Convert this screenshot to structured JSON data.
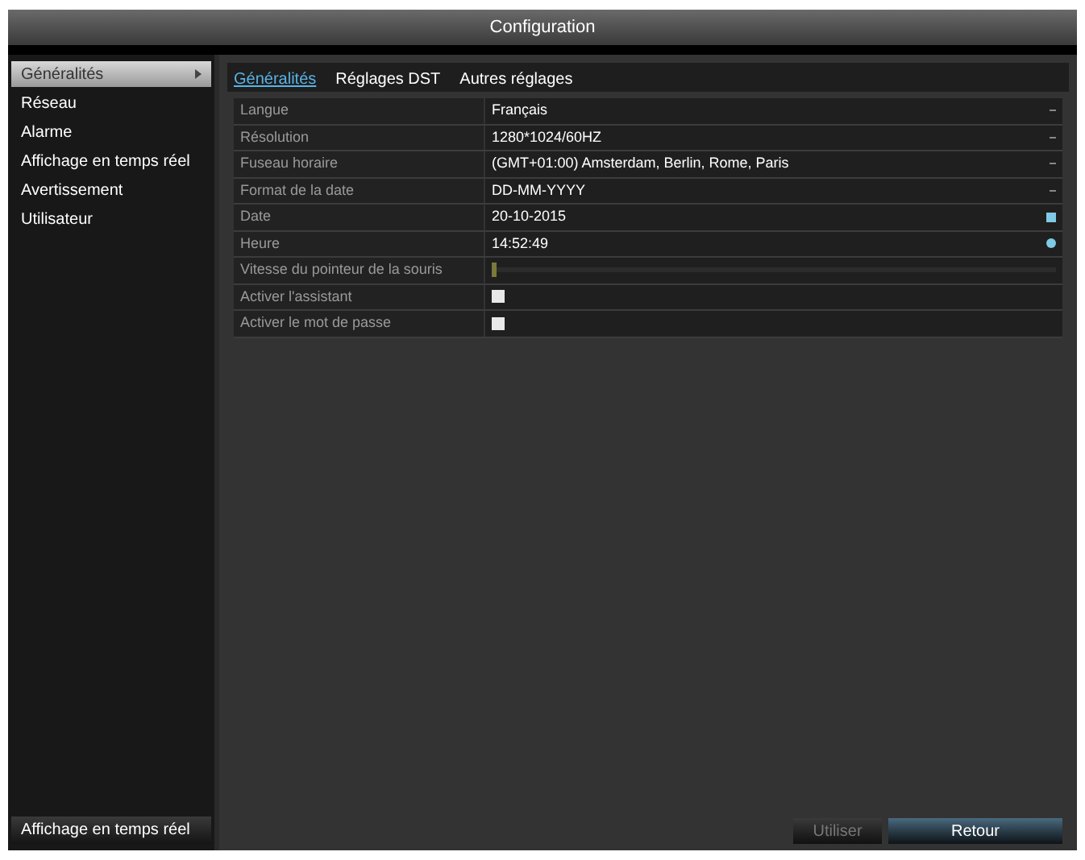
{
  "window": {
    "title": "Configuration"
  },
  "sidebar": {
    "items": [
      {
        "label": "Généralités",
        "selected": true
      },
      {
        "label": "Réseau",
        "selected": false
      },
      {
        "label": "Alarme",
        "selected": false
      },
      {
        "label": "Affichage en temps réel",
        "selected": false
      },
      {
        "label": "Avertissement",
        "selected": false
      },
      {
        "label": "Utilisateur",
        "selected": false
      }
    ],
    "bottom_button": "Affichage en temps réel"
  },
  "tabs": [
    {
      "label": "Généralités",
      "selected": true
    },
    {
      "label": "Réglages DST",
      "selected": false
    },
    {
      "label": "Autres réglages",
      "selected": false
    }
  ],
  "rows": [
    {
      "kind": "dropdown",
      "label": "Langue",
      "value": "Français"
    },
    {
      "kind": "dropdown",
      "label": "Résolution",
      "value": "1280*1024/60HZ"
    },
    {
      "kind": "dropdown",
      "label": "Fuseau horaire",
      "value": "(GMT+01:00) Amsterdam, Berlin, Rome, Paris"
    },
    {
      "kind": "dropdown",
      "label": "Format de la date",
      "value": "DD-MM-YYYY"
    },
    {
      "kind": "date",
      "label": "Date",
      "value": "20-10-2015"
    },
    {
      "kind": "time",
      "label": "Heure",
      "value": "14:52:49"
    },
    {
      "kind": "slider",
      "label": "Vitesse du pointeur de la souris",
      "level": 0
    },
    {
      "kind": "checkbox",
      "label": "Activer l'assistant",
      "checked": false
    },
    {
      "kind": "checkbox",
      "label": "Activer le mot de passe",
      "checked": false
    }
  ],
  "buttons": [
    {
      "label": "Utiliser",
      "disabled": true
    },
    {
      "label": "Retour",
      "disabled": false
    }
  ]
}
